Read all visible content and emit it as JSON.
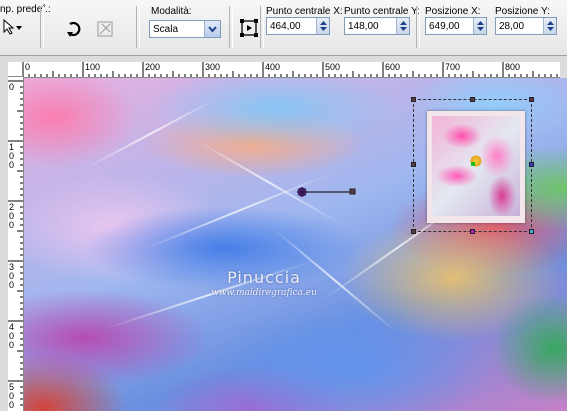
{
  "toolbar": {
    "preset_label": "np. predef.:",
    "mode": {
      "label": "Modalità:",
      "value": "Scala"
    },
    "center_x": {
      "label": "Punto centrale X:",
      "value": "464,00"
    },
    "center_y": {
      "label": "Punto centrale Y:",
      "value": "148,00"
    },
    "pos_x": {
      "label": "Posizione X:",
      "value": "649,00"
    },
    "pos_y": {
      "label": "Posizione Y:",
      "value": "28,00"
    }
  },
  "ruler": {
    "horizontal": [
      "0",
      "100",
      "200",
      "300",
      "400",
      "500",
      "600",
      "700",
      "800"
    ],
    "vertical": [
      "0",
      "100",
      "200",
      "300",
      "400",
      "500"
    ]
  },
  "watermark": {
    "title": "Pinuccia",
    "url": "www.maidiregrafica.eu"
  },
  "colors": {
    "accent": "#7f9db9",
    "selection": "#333333"
  }
}
